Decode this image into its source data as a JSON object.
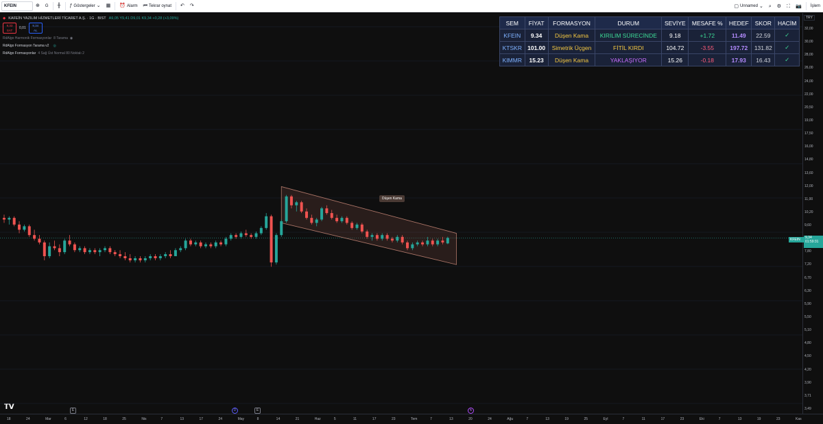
{
  "toolbar": {
    "symbol": "KFEIN",
    "interval": "G",
    "indicators_label": "Göstergeler",
    "alarm_label": "Alarm",
    "replay_label": "Tekrar oynat",
    "layout_name": "Unnamed",
    "trade_label": "İşlem"
  },
  "legend": {
    "title": "KAFEİN YAZILIM HİZMETLERİ TİCARET A.Ş. · 1G · BIST",
    "ohlc": "A9,05 Y9,41 D9,01 K9,34 +0,28 (+3,09%)",
    "sell_price": "9,33",
    "sell_label": "SAT",
    "mid_price": "0,01",
    "buy_price": "9,34",
    "buy_label": "AL",
    "indicators": [
      {
        "name": "RdAlgo Harmonik Formasyonlar",
        "params": "8 Tarama"
      },
      {
        "name": "RdAlgo Formasyon Tarama v2",
        "params": ""
      },
      {
        "name": "RdAlgo Formasyonlar",
        "params": "4 Sağ Üst Normal 80 Noktalı 2"
      }
    ]
  },
  "table": {
    "headers": [
      "SEM",
      "FİYAT",
      "FORMASYON",
      "DURUM",
      "SEVİYE",
      "MESAFE %",
      "HEDEF",
      "SKOR",
      "HACİM"
    ],
    "rows": [
      {
        "sem": "KFEIN",
        "price": "9.34",
        "formation": "Düşen Kama",
        "status": "KIRILIM SÜRECİNDE",
        "status_color": "green",
        "level": "9.18",
        "distance": "+1.72",
        "distance_sign": "pos",
        "target": "11.49",
        "score": "22.59",
        "volume": "✓"
      },
      {
        "sem": "KTSKR",
        "price": "101.00",
        "formation": "Simetrik Üçgen",
        "status": "FİTİL KIRDI",
        "status_color": "yellow",
        "level": "104.72",
        "distance": "-3.55",
        "distance_sign": "neg",
        "target": "197.72",
        "score": "131.82",
        "volume": "✓"
      },
      {
        "sem": "KIMMR",
        "price": "15.23",
        "formation": "Düşen Kama",
        "status": "YAKLAŞIYOR",
        "status_color": "purple",
        "level": "15.26",
        "distance": "-0.18",
        "distance_sign": "neg",
        "target": "17.93",
        "score": "16.43",
        "volume": "✓"
      }
    ]
  },
  "pattern_label": "Düşen Kama",
  "current_price": {
    "symbol": "KFEIN",
    "value": "9,34",
    "countdown": "01:59:31"
  },
  "currency": "TRY",
  "colors": {
    "up": "#26a69a",
    "down": "#ef5350",
    "background": "#0f0f0f",
    "table_bg": "#1a2238"
  },
  "price_axis": [
    "32,00",
    "30,00",
    "28,00",
    "26,00",
    "24,00",
    "22,00",
    "20,50",
    "19,00",
    "17,50",
    "16,00",
    "14,80",
    "13,60",
    "12,00",
    "11,00",
    "10,20",
    "9,60",
    "8,40",
    "7,80",
    "7,20",
    "6,70",
    "6,30",
    "5,90",
    "5,50",
    "5,10",
    "4,80",
    "4,50",
    "4,20",
    "3,90",
    "3,71",
    "3,49"
  ],
  "time_axis": [
    "18",
    "24",
    "Mar",
    "6",
    "12",
    "18",
    "25",
    "Nis",
    "7",
    "13",
    "17",
    "24",
    "May",
    "8",
    "14",
    "21",
    "Haz",
    "5",
    "11",
    "17",
    "23",
    "Tem",
    "7",
    "13",
    "20",
    "24",
    "Ağu",
    "7",
    "13",
    "19",
    "25",
    "Eyl",
    "7",
    "11",
    "17",
    "23",
    "Eki",
    "7",
    "13",
    "19",
    "23",
    "Kas"
  ],
  "chart_data": {
    "type": "candlestick",
    "symbol": "KFEIN",
    "ylim": [
      3.49,
      32.0
    ],
    "candles": [
      {
        "o": 10.5,
        "h": 10.7,
        "l": 10.2,
        "c": 10.4
      },
      {
        "o": 10.4,
        "h": 10.6,
        "l": 10.1,
        "c": 10.5
      },
      {
        "o": 10.5,
        "h": 10.6,
        "l": 10.0,
        "c": 10.1
      },
      {
        "o": 10.1,
        "h": 10.3,
        "l": 9.6,
        "c": 9.8
      },
      {
        "o": 9.8,
        "h": 10.1,
        "l": 9.7,
        "c": 10.0
      },
      {
        "o": 10.0,
        "h": 10.1,
        "l": 9.4,
        "c": 9.5
      },
      {
        "o": 9.5,
        "h": 9.8,
        "l": 9.2,
        "c": 9.3
      },
      {
        "o": 9.3,
        "h": 9.5,
        "l": 9.0,
        "c": 9.1
      },
      {
        "o": 9.1,
        "h": 9.2,
        "l": 8.2,
        "c": 8.4
      },
      {
        "o": 8.4,
        "h": 9.1,
        "l": 8.3,
        "c": 8.9
      },
      {
        "o": 8.9,
        "h": 9.2,
        "l": 8.7,
        "c": 8.8
      },
      {
        "o": 8.8,
        "h": 9.0,
        "l": 8.4,
        "c": 8.6
      },
      {
        "o": 8.6,
        "h": 9.3,
        "l": 8.5,
        "c": 9.2
      },
      {
        "o": 9.2,
        "h": 9.5,
        "l": 8.9,
        "c": 9.0
      },
      {
        "o": 9.0,
        "h": 9.1,
        "l": 8.6,
        "c": 8.7
      },
      {
        "o": 8.7,
        "h": 8.9,
        "l": 8.6,
        "c": 8.8
      },
      {
        "o": 8.8,
        "h": 8.9,
        "l": 8.5,
        "c": 8.6
      },
      {
        "o": 8.6,
        "h": 8.8,
        "l": 8.5,
        "c": 8.7
      },
      {
        "o": 8.7,
        "h": 8.8,
        "l": 8.5,
        "c": 8.6
      },
      {
        "o": 8.6,
        "h": 8.8,
        "l": 8.4,
        "c": 8.7
      },
      {
        "o": 8.7,
        "h": 8.9,
        "l": 8.6,
        "c": 8.8
      },
      {
        "o": 8.8,
        "h": 8.9,
        "l": 8.5,
        "c": 8.6
      },
      {
        "o": 8.6,
        "h": 8.7,
        "l": 8.4,
        "c": 8.5
      },
      {
        "o": 8.5,
        "h": 8.7,
        "l": 8.3,
        "c": 8.4
      },
      {
        "o": 8.4,
        "h": 8.6,
        "l": 8.2,
        "c": 8.3
      },
      {
        "o": 8.3,
        "h": 8.5,
        "l": 8.1,
        "c": 8.2
      },
      {
        "o": 8.2,
        "h": 8.4,
        "l": 8.1,
        "c": 8.3
      },
      {
        "o": 8.3,
        "h": 8.4,
        "l": 8.1,
        "c": 8.2
      },
      {
        "o": 8.2,
        "h": 8.4,
        "l": 8.1,
        "c": 8.3
      },
      {
        "o": 8.3,
        "h": 8.5,
        "l": 8.2,
        "c": 8.4
      },
      {
        "o": 8.4,
        "h": 8.5,
        "l": 8.2,
        "c": 8.3
      },
      {
        "o": 8.3,
        "h": 8.5,
        "l": 8.2,
        "c": 8.4
      },
      {
        "o": 8.4,
        "h": 8.6,
        "l": 8.3,
        "c": 8.5
      },
      {
        "o": 8.5,
        "h": 8.7,
        "l": 8.3,
        "c": 8.4
      },
      {
        "o": 8.4,
        "h": 8.8,
        "l": 8.4,
        "c": 8.7
      },
      {
        "o": 8.7,
        "h": 8.9,
        "l": 8.6,
        "c": 8.8
      },
      {
        "o": 8.8,
        "h": 9.3,
        "l": 8.7,
        "c": 9.2
      },
      {
        "o": 9.2,
        "h": 9.3,
        "l": 8.9,
        "c": 9.0
      },
      {
        "o": 9.0,
        "h": 9.2,
        "l": 8.9,
        "c": 9.1
      },
      {
        "o": 9.1,
        "h": 9.2,
        "l": 8.8,
        "c": 8.9
      },
      {
        "o": 8.9,
        "h": 9.1,
        "l": 8.8,
        "c": 9.0
      },
      {
        "o": 9.0,
        "h": 9.1,
        "l": 8.8,
        "c": 8.9
      },
      {
        "o": 8.9,
        "h": 9.2,
        "l": 8.8,
        "c": 9.1
      },
      {
        "o": 9.1,
        "h": 9.2,
        "l": 8.9,
        "c": 9.0
      },
      {
        "o": 9.0,
        "h": 9.4,
        "l": 8.9,
        "c": 9.3
      },
      {
        "o": 9.3,
        "h": 9.6,
        "l": 9.2,
        "c": 9.5
      },
      {
        "o": 9.5,
        "h": 9.6,
        "l": 9.3,
        "c": 9.4
      },
      {
        "o": 9.4,
        "h": 9.7,
        "l": 9.3,
        "c": 9.6
      },
      {
        "o": 9.6,
        "h": 9.8,
        "l": 9.4,
        "c": 9.5
      },
      {
        "o": 9.5,
        "h": 9.6,
        "l": 9.3,
        "c": 9.4
      },
      {
        "o": 9.4,
        "h": 9.7,
        "l": 9.3,
        "c": 9.6
      },
      {
        "o": 9.6,
        "h": 10.0,
        "l": 9.5,
        "c": 9.9
      },
      {
        "o": 9.9,
        "h": 10.8,
        "l": 9.8,
        "c": 10.6
      },
      {
        "o": 10.6,
        "h": 10.7,
        "l": 7.9,
        "c": 8.1
      },
      {
        "o": 8.1,
        "h": 9.6,
        "l": 8.0,
        "c": 9.5
      },
      {
        "o": 9.5,
        "h": 10.4,
        "l": 9.4,
        "c": 10.3
      },
      {
        "o": 10.3,
        "h": 12.0,
        "l": 10.2,
        "c": 11.9
      },
      {
        "o": 11.9,
        "h": 12.0,
        "l": 11.1,
        "c": 11.3
      },
      {
        "o": 11.3,
        "h": 11.6,
        "l": 10.9,
        "c": 11.5
      },
      {
        "o": 11.5,
        "h": 11.6,
        "l": 10.8,
        "c": 10.9
      },
      {
        "o": 10.9,
        "h": 11.1,
        "l": 10.4,
        "c": 10.5
      },
      {
        "o": 10.5,
        "h": 10.7,
        "l": 10.1,
        "c": 10.2
      },
      {
        "o": 10.2,
        "h": 10.5,
        "l": 10.0,
        "c": 10.4
      },
      {
        "o": 10.4,
        "h": 11.2,
        "l": 10.3,
        "c": 11.1
      },
      {
        "o": 11.1,
        "h": 11.3,
        "l": 10.7,
        "c": 10.8
      },
      {
        "o": 10.8,
        "h": 11.0,
        "l": 10.4,
        "c": 10.5
      },
      {
        "o": 10.5,
        "h": 10.7,
        "l": 10.2,
        "c": 10.3
      },
      {
        "o": 10.3,
        "h": 10.6,
        "l": 10.2,
        "c": 10.5
      },
      {
        "o": 10.5,
        "h": 10.6,
        "l": 10.1,
        "c": 10.2
      },
      {
        "o": 10.2,
        "h": 10.3,
        "l": 9.8,
        "c": 9.9
      },
      {
        "o": 9.9,
        "h": 10.2,
        "l": 9.8,
        "c": 10.1
      },
      {
        "o": 10.1,
        "h": 10.2,
        "l": 9.6,
        "c": 9.7
      },
      {
        "o": 9.7,
        "h": 9.8,
        "l": 9.3,
        "c": 9.4
      },
      {
        "o": 9.4,
        "h": 9.6,
        "l": 9.2,
        "c": 9.5
      },
      {
        "o": 9.5,
        "h": 9.6,
        "l": 9.2,
        "c": 9.3
      },
      {
        "o": 9.3,
        "h": 9.6,
        "l": 9.2,
        "c": 9.5
      },
      {
        "o": 9.5,
        "h": 9.6,
        "l": 9.2,
        "c": 9.3
      },
      {
        "o": 9.3,
        "h": 9.4,
        "l": 9.1,
        "c": 9.2
      },
      {
        "o": 9.2,
        "h": 9.5,
        "l": 9.1,
        "c": 9.4
      },
      {
        "o": 9.4,
        "h": 9.5,
        "l": 9.0,
        "c": 9.1
      },
      {
        "o": 9.1,
        "h": 9.2,
        "l": 8.7,
        "c": 8.8
      },
      {
        "o": 8.8,
        "h": 9.1,
        "l": 8.7,
        "c": 9.0
      },
      {
        "o": 9.0,
        "h": 9.2,
        "l": 8.9,
        "c": 9.1
      },
      {
        "o": 9.1,
        "h": 9.2,
        "l": 8.9,
        "c": 9.0
      },
      {
        "o": 9.0,
        "h": 9.4,
        "l": 8.9,
        "c": 9.2
      },
      {
        "o": 9.2,
        "h": 9.3,
        "l": 8.9,
        "c": 9.0
      },
      {
        "o": 9.0,
        "h": 9.3,
        "l": 8.9,
        "c": 9.2
      },
      {
        "o": 9.2,
        "h": 9.4,
        "l": 9.0,
        "c": 9.1
      },
      {
        "o": 9.05,
        "h": 9.41,
        "l": 9.01,
        "c": 9.34
      }
    ]
  }
}
